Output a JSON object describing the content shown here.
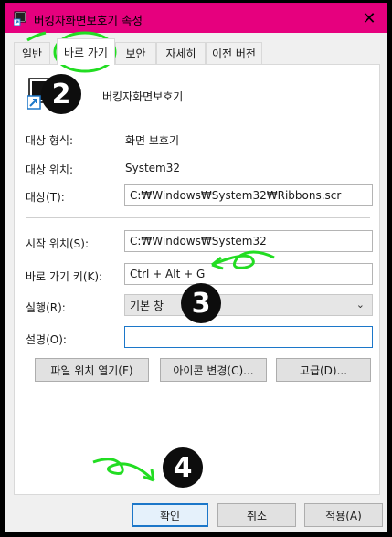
{
  "window": {
    "title": "버킹자화면보호기 속성",
    "close_glyph": "✕"
  },
  "tabs": [
    {
      "label": "일반",
      "active": false
    },
    {
      "label": "바로 가기",
      "active": true
    },
    {
      "label": "보안",
      "active": false
    },
    {
      "label": "자세히",
      "active": false
    },
    {
      "label": "이전 버전",
      "active": false
    }
  ],
  "header": {
    "name": "버킹자화면보호기"
  },
  "info": {
    "type_label": "대상 형식:",
    "type_value": "화면 보호기",
    "location_label": "대상 위치:",
    "location_value": "System32",
    "target_label": "대상(T):",
    "target_value": "C:₩Windows₩System32₩Ribbons.scr"
  },
  "fields": {
    "start_label": "시작 위치(S):",
    "start_value": "C:₩Windows₩System32",
    "hotkey_label": "바로 가기 키(K):",
    "hotkey_value": "Ctrl + Alt + G",
    "run_label": "실행(R):",
    "run_value": "기본 창",
    "comment_label": "설명(O):",
    "comment_value": ""
  },
  "actions": {
    "open_location": "파일 위치 열기(F)",
    "change_icon": "아이콘 변경(C)...",
    "advanced": "고급(D)..."
  },
  "footer": {
    "ok": "확인",
    "cancel": "취소",
    "apply": "적용(A)"
  },
  "annotations": {
    "step2": "2",
    "step3": "3",
    "step4": "4",
    "highlight_color": "#22dd22"
  }
}
